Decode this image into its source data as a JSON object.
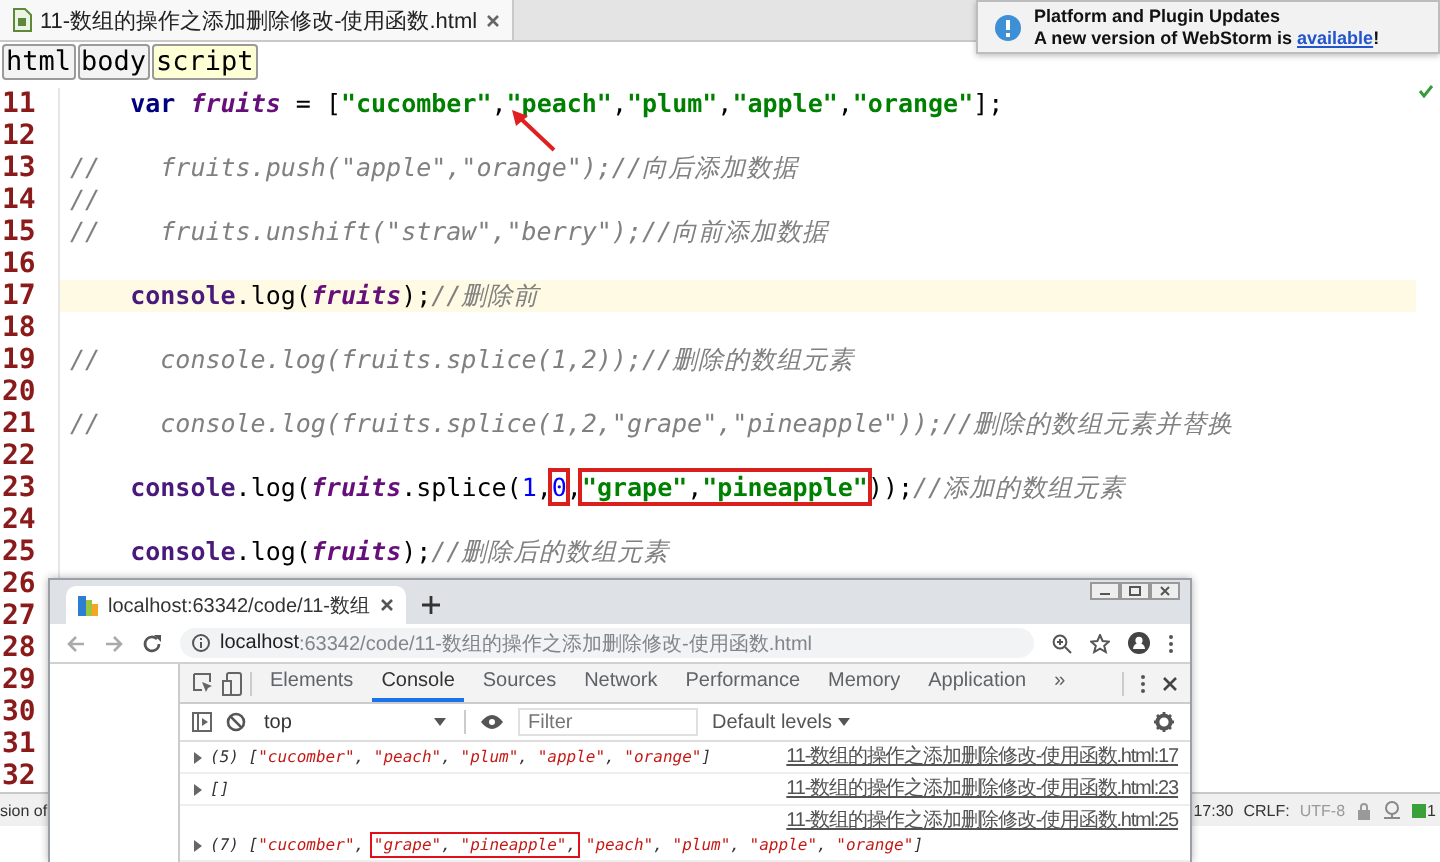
{
  "editor_tab": {
    "title": "11-数组的操作之添加删除修改-使用函数.html",
    "selected": true
  },
  "notification": {
    "title": "Platform and Plugin Updates",
    "message_before": "A new version of WebStorm is ",
    "link": "available",
    "message_after": "!"
  },
  "breadcrumbs": [
    {
      "label": "html",
      "selected": false
    },
    {
      "label": "body",
      "selected": false
    },
    {
      "label": "script",
      "selected": true
    }
  ],
  "code": {
    "lines": [
      {
        "number": "11",
        "current": false,
        "tokens": [
          {
            "kind": "keyword",
            "text": "    var"
          },
          {
            "kind": "variable",
            "text": " fruits"
          },
          {
            "kind": "plain",
            "text": " = ["
          },
          {
            "kind": "string",
            "text": "\"cucomber\""
          },
          {
            "kind": "plain",
            "text": ","
          },
          {
            "kind": "string",
            "text": "\"peach\""
          },
          {
            "kind": "plain",
            "text": ","
          },
          {
            "kind": "string",
            "text": "\"plum\""
          },
          {
            "kind": "plain",
            "text": ","
          },
          {
            "kind": "string",
            "text": "\"apple\""
          },
          {
            "kind": "plain",
            "text": ","
          },
          {
            "kind": "string",
            "text": "\"orange\""
          },
          {
            "kind": "plain",
            "text": "];"
          }
        ]
      },
      {
        "number": "12",
        "current": false
      },
      {
        "number": "13",
        "current": false,
        "tokens": [
          {
            "kind": "comment",
            "text": "//    fruits.push(\"apple\",\"orange\");//向后添加数据"
          }
        ]
      },
      {
        "number": "14",
        "current": false,
        "tokens": [
          {
            "kind": "comment",
            "text": "//"
          }
        ]
      },
      {
        "number": "15",
        "current": false,
        "tokens": [
          {
            "kind": "comment",
            "text": "//    fruits.unshift(\"straw\",\"berry\");//向前添加数据"
          }
        ]
      },
      {
        "number": "16",
        "current": false
      },
      {
        "number": "17",
        "current": true,
        "tokens": [
          {
            "kind": "global",
            "text": "    console"
          },
          {
            "kind": "plain",
            "text": ".log("
          },
          {
            "kind": "variable",
            "text": "fruits"
          },
          {
            "kind": "plain",
            "text": ");"
          },
          {
            "kind": "comment",
            "text": "//删除前"
          }
        ]
      },
      {
        "number": "18",
        "current": false
      },
      {
        "number": "19",
        "current": false,
        "tokens": [
          {
            "kind": "comment",
            "text": "//    console.log(fruits.splice(1,2));//删除的数组元素"
          }
        ]
      },
      {
        "number": "20",
        "current": false
      },
      {
        "number": "21",
        "current": false,
        "tokens": [
          {
            "kind": "comment",
            "text": "//    console.log(fruits.splice(1,2,\"grape\",\"pineapple\"));//删除的数组元素并替换"
          }
        ]
      },
      {
        "number": "22",
        "current": false
      },
      {
        "number": "23",
        "current": false,
        "tokens": [
          {
            "kind": "global",
            "text": "    console"
          },
          {
            "kind": "plain",
            "text": ".log("
          },
          {
            "kind": "variable",
            "text": "fruits"
          },
          {
            "kind": "plain",
            "text": ".splice("
          },
          {
            "kind": "number",
            "text": "1"
          },
          {
            "kind": "plain",
            "text": ","
          },
          {
            "kind": "box",
            "tokens": [
              {
                "kind": "number",
                "text": "0"
              }
            ]
          },
          {
            "kind": "plain",
            "text": ","
          },
          {
            "kind": "box",
            "tokens": [
              {
                "kind": "string",
                "text": "\"grape\""
              },
              {
                "kind": "plain",
                "text": ","
              },
              {
                "kind": "string",
                "text": "\"pineapple\""
              }
            ]
          },
          {
            "kind": "plain",
            "text": "));"
          },
          {
            "kind": "comment",
            "text": "//添加的数组元素"
          }
        ]
      },
      {
        "number": "24",
        "current": false
      },
      {
        "number": "25",
        "current": false,
        "tokens": [
          {
            "kind": "global",
            "text": "    console"
          },
          {
            "kind": "plain",
            "text": ".log("
          },
          {
            "kind": "variable",
            "text": "fruits"
          },
          {
            "kind": "plain",
            "text": ");"
          },
          {
            "kind": "comment",
            "text": "//删除后的数组元素"
          }
        ]
      },
      {
        "number": "26",
        "current": false
      },
      {
        "number": "27",
        "current": false
      },
      {
        "number": "28",
        "current": false
      },
      {
        "number": "29",
        "current": false
      },
      {
        "number": "30",
        "current": false
      },
      {
        "number": "31",
        "current": false
      },
      {
        "number": "32",
        "current": false
      }
    ]
  },
  "annotations": [
    {
      "kind": "arrow"
    }
  ],
  "browser": {
    "tab": {
      "title": "localhost:63342/code/11-数组",
      "selected": true
    },
    "url_host": "localhost",
    "url_rest": ":63342/code/11-数组的操作之添加删除修改-使用函数.html",
    "devtools": {
      "tabs": [
        {
          "label": "Elements",
          "selected": false
        },
        {
          "label": "Console",
          "selected": true
        },
        {
          "label": "Sources",
          "selected": false
        },
        {
          "label": "Network",
          "selected": false
        },
        {
          "label": "Performance",
          "selected": false
        },
        {
          "label": "Memory",
          "selected": false
        },
        {
          "label": "Application",
          "selected": false
        }
      ],
      "more": "»",
      "context": "top",
      "filter_placeholder": "Filter",
      "levels": "Default levels",
      "messages": [
        {
          "expanded": false,
          "source": "11-数组的操作之添加删除修改-使用函数.html:17",
          "tokens": [
            {
              "kind": "count",
              "text": "(5) "
            },
            {
              "kind": "plain",
              "text": "["
            },
            {
              "kind": "string",
              "text": "\"cucomber\""
            },
            {
              "kind": "plain",
              "text": ", "
            },
            {
              "kind": "string",
              "text": "\"peach\""
            },
            {
              "kind": "plain",
              "text": ", "
            },
            {
              "kind": "string",
              "text": "\"plum\""
            },
            {
              "kind": "plain",
              "text": ", "
            },
            {
              "kind": "string",
              "text": "\"apple\""
            },
            {
              "kind": "plain",
              "text": ", "
            },
            {
              "kind": "string",
              "text": "\"orange\""
            },
            {
              "kind": "plain",
              "text": "]"
            }
          ]
        },
        {
          "expanded": false,
          "source": "11-数组的操作之添加删除修改-使用函数.html:23",
          "tokens": [
            {
              "kind": "plain",
              "text": "[]"
            }
          ]
        },
        {
          "expanded": false,
          "source": "11-数组的操作之添加删除修改-使用函数.html:25",
          "tokens": [
            {
              "kind": "count",
              "text": "(7) "
            },
            {
              "kind": "plain",
              "text": "["
            },
            {
              "kind": "string",
              "text": "\"cucomber\""
            },
            {
              "kind": "plain",
              "text": ", "
            },
            {
              "kind": "box",
              "tokens": [
                {
                  "kind": "string",
                  "text": "\"grape\""
                },
                {
                  "kind": "plain",
                  "text": ", "
                },
                {
                  "kind": "string",
                  "text": "\"pineapple\""
                },
                {
                  "kind": "plain",
                  "text": ","
                }
              ]
            },
            {
              "kind": "string",
              "text": " \"peach\""
            },
            {
              "kind": "plain",
              "text": ", "
            },
            {
              "kind": "string",
              "text": "\"plum\""
            },
            {
              "kind": "plain",
              "text": ", "
            },
            {
              "kind": "string",
              "text": "\"apple\""
            },
            {
              "kind": "plain",
              "text": ", "
            },
            {
              "kind": "string",
              "text": "\"orange\""
            },
            {
              "kind": "plain",
              "text": "]"
            }
          ]
        }
      ]
    }
  },
  "status_bar": {
    "left_text": "sion of",
    "position": "17:30",
    "line_separator": "CRLF:",
    "encoding": "UTF-8",
    "event_count": "1"
  }
}
